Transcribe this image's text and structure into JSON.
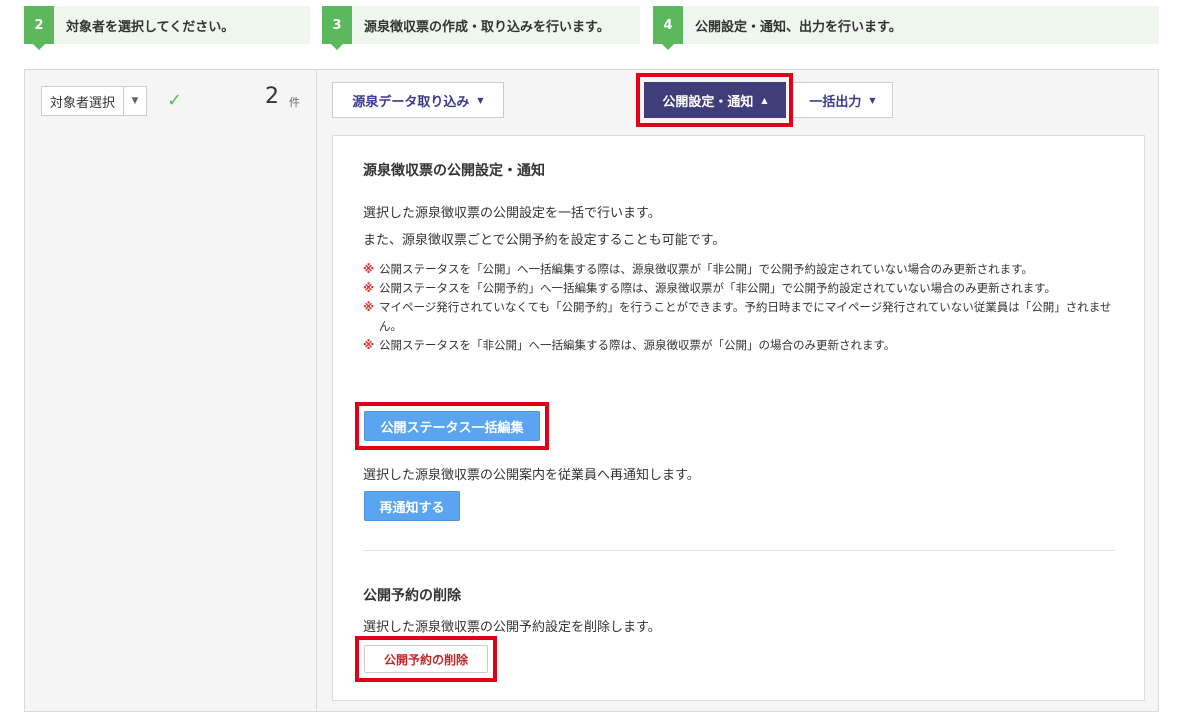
{
  "steps": [
    {
      "num": "2",
      "label": "対象者を選択してください。"
    },
    {
      "num": "3",
      "label": "源泉徴収票の作成・取り込みを行います。"
    },
    {
      "num": "4",
      "label": "公開設定・通知、出力を行います。"
    }
  ],
  "left": {
    "selector_label": "対象者選択",
    "check": "✓",
    "count": "2",
    "count_unit": "件"
  },
  "toolbar": {
    "import_label": "源泉データ取り込み",
    "public_label": "公開設定・通知",
    "output_label": "一括出力"
  },
  "panel": {
    "title": "源泉徴収票の公開設定・通知",
    "desc1": "選択した源泉徴収票の公開設定を一括で行います。",
    "desc2": "また、源泉徴収票ごとで公開予約を設定することも可能です。",
    "note_mark": "※",
    "notes": [
      "公開ステータスを「公開」へ一括編集する際は、源泉徴収票が「非公開」で公開予約設定されていない場合のみ更新されます。",
      "公開ステータスを「公開予約」へ一括編集する際は、源泉徴収票が「非公開」で公開予約設定されていない場合のみ更新されます。",
      "マイページ発行されていなくても「公開予約」を行うことができます。予約日時までにマイページ発行されていない従業員は「公開」されません。",
      "公開ステータスを「非公開」へ一括編集する際は、源泉徴収票が「公開」の場合のみ更新されます。"
    ],
    "bulk_edit_label": "公開ステータス一括編集",
    "renotify_desc": "選択した源泉徴収票の公開案内を従業員へ再通知します。",
    "renotify_label": "再通知する",
    "delete_title": "公開予約の削除",
    "delete_desc": "選択した源泉徴収票の公開予約設定を削除します。",
    "delete_label": "公開予約の削除"
  },
  "colors": {
    "step_green": "#5cb85c",
    "primary_dark": "#3f3d7a",
    "blue_button": "#5ba4f0",
    "highlight_red": "#e0001a",
    "delete_red": "#c0292b"
  }
}
